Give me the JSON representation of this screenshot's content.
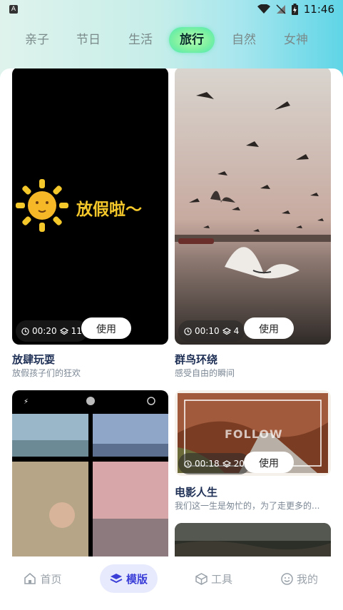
{
  "status": {
    "app_badge": "A",
    "time": "11:46"
  },
  "tabs": [
    {
      "label": "亲子",
      "active": false
    },
    {
      "label": "节日",
      "active": false
    },
    {
      "label": "生活",
      "active": false
    },
    {
      "label": "旅行",
      "active": true
    },
    {
      "label": "自然",
      "active": false
    },
    {
      "label": "女神",
      "active": false
    }
  ],
  "cards": [
    {
      "title": "放肆玩耍",
      "subtitle": "放假孩子们的狂欢",
      "duration": "00:20",
      "layers": "11",
      "use_label": "使用",
      "overlay_text": "放假啦～"
    },
    {
      "title": "群鸟环绕",
      "subtitle": "感受自由的瞬间",
      "duration": "00:10",
      "layers": "4",
      "use_label": "使用"
    },
    {
      "title": "",
      "subtitle": "",
      "duration": "",
      "layers": "",
      "use_label": ""
    },
    {
      "title": "电影人生",
      "subtitle": "我们这一生是匆忙的，为了走更多的...",
      "duration": "00:18",
      "layers": "20",
      "use_label": "使用",
      "overlay_text": "FOLLOW"
    }
  ],
  "bottom_nav": [
    {
      "label": "首页",
      "icon": "home-icon",
      "active": false
    },
    {
      "label": "模版",
      "icon": "layers-icon",
      "active": true
    },
    {
      "label": "工具",
      "icon": "cube-icon",
      "active": false
    },
    {
      "label": "我的",
      "icon": "smile-icon",
      "active": false
    }
  ],
  "colors": {
    "accent": "#3b3fd8",
    "tab_active": "#7ef1a1",
    "title": "#1e2f55"
  }
}
